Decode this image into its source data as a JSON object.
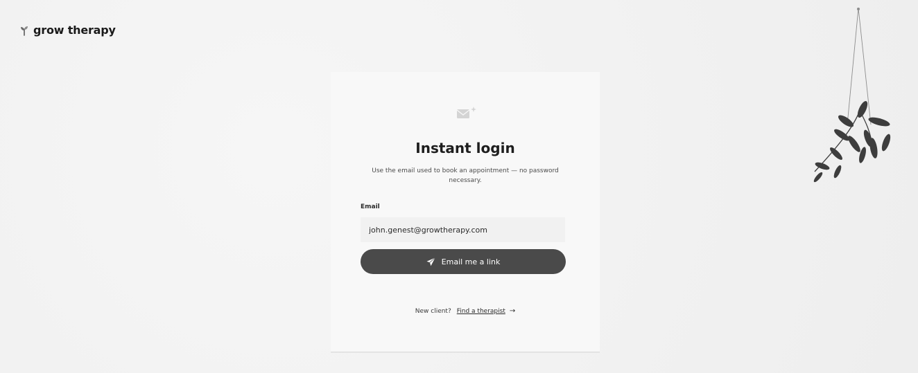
{
  "brand": {
    "name": "grow therapy",
    "logo_icon": "sprout-icon"
  },
  "login": {
    "icon": "envelope-sparkle-icon",
    "title": "Instant login",
    "subtitle": "Use the email used to book an appointment — no password necessary.",
    "email_label": "Email",
    "email_value": "john.genest@growtherapy.com",
    "submit_label": "Email me a link",
    "submit_icon": "paper-plane-icon",
    "new_client_text": "New client?",
    "find_therapist_link": "Find a therapist",
    "find_therapist_arrow": "→"
  },
  "decor": {
    "plant": "hanging-plant-illustration"
  },
  "colors": {
    "button": "#4a4a4a",
    "page_background": "#f3f3f3",
    "card_background": "#f8f8f8"
  }
}
